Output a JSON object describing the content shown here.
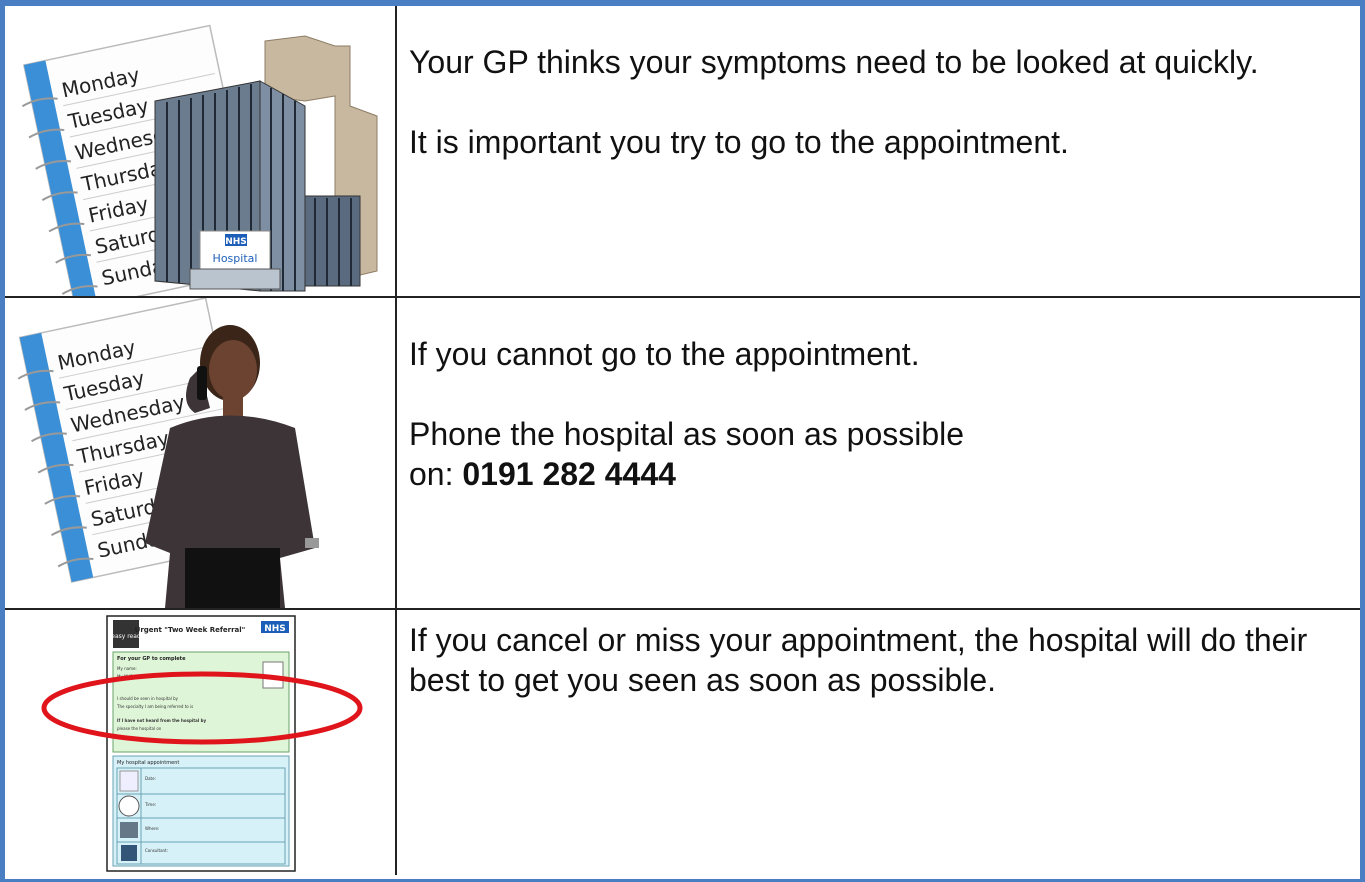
{
  "rows": [
    {
      "image_days": [
        "Monday",
        "Tuesday",
        "Wednesday",
        "Thursday",
        "Friday",
        "Saturday",
        "Sunday"
      ],
      "image_sign_top": "NHS",
      "image_sign": "Hospital",
      "paragraphs": [
        "Your GP thinks your symptoms need to be looked at quickly.",
        "It is important you try to go to the appointment."
      ]
    },
    {
      "image_days": [
        "Monday",
        "Tuesday",
        "Wednesday",
        "Thursday",
        "Friday",
        "Saturday",
        "Sunday"
      ],
      "para1": "If you cannot go to the appointment.",
      "para2_line1": "Phone the hospital as soon as possible",
      "para2_prefix": "on: ",
      "phone": "0191 282 4444"
    },
    {
      "form_title": "Urgent \"Two Week Referral\"",
      "form_badge": "NHS",
      "form_logo": "easy read",
      "form_section1": "For your GP to complete",
      "form_lines1": [
        "My name:",
        "My NHS number:"
      ],
      "form_lines2": [
        "I should be seen in hospital by",
        "The specialty I am being referred to is"
      ],
      "form_lines3": [
        "If I have not heard from the hospital by",
        "please the hospital on"
      ],
      "form_section2": "My hospital appointment",
      "form_fields": [
        "Date:",
        "Time:",
        "Where:",
        "Consultant:"
      ],
      "paragraphs": [
        "If you cancel or miss your appointment, the hospital will do their best to get you seen as soon as possible."
      ]
    }
  ],
  "colors": {
    "border_accent": "#4a7ec3",
    "calendar_spine": "#3b8fd6",
    "highlight_ellipse": "#e0141b",
    "form_green": "#dff5d8",
    "form_blue": "#d6f1f7"
  }
}
